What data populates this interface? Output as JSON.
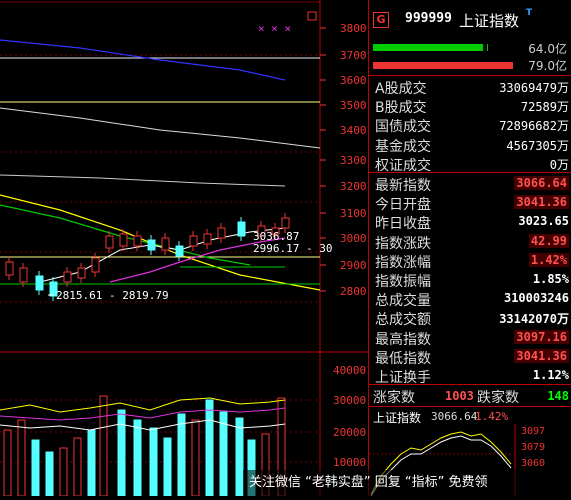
{
  "chart": {
    "price_ticks": [
      "3800",
      "3700",
      "3600",
      "3500",
      "3400",
      "3300",
      "3200",
      "3100",
      "3000",
      "2900",
      "2800"
    ],
    "volume_ticks": [
      "40000",
      "30000",
      "20000",
      "10000"
    ],
    "annotations": {
      "low_range": "2815.61 - 2819.79",
      "high_a": "3036.87",
      "high_b": "2996.17 - 30"
    },
    "marks": "× × ×"
  },
  "panel": {
    "badge": "G",
    "code": "999999",
    "name": "上证指数",
    "tmark": "T",
    "vol_top": "64.0亿",
    "vol_bottom": "79.0亿",
    "rows_a": [
      {
        "k": "A股成交",
        "v": "33069479万"
      },
      {
        "k": "B股成交",
        "v": "72589万"
      },
      {
        "k": "国债成交",
        "v": "72896682万"
      },
      {
        "k": "基金成交",
        "v": "4567305万"
      },
      {
        "k": "权证成交",
        "v": "0万"
      }
    ],
    "rows_b": [
      {
        "k": "最新指数",
        "v": "3066.64"
      },
      {
        "k": "今日开盘",
        "v": "3041.36"
      },
      {
        "k": "昨日收盘",
        "v": "3023.65"
      },
      {
        "k": "指数涨跌",
        "v": "42.99"
      },
      {
        "k": "指数涨幅",
        "v": "1.42%"
      },
      {
        "k": "指数振幅",
        "v": "1.85%"
      },
      {
        "k": "总成交量",
        "v": "310003246"
      },
      {
        "k": "总成交额",
        "v": "33142070万"
      },
      {
        "k": "最高指数",
        "v": "3097.16"
      },
      {
        "k": "最低指数",
        "v": "3041.36"
      },
      {
        "k": "上证换手",
        "v": "1.12%"
      }
    ],
    "up_label": "涨家数",
    "up_count": "1003",
    "down_label": "跌家数",
    "down_count": "148",
    "mini_title": "上证指数",
    "mini_price": "3066.64",
    "mini_change": "1.42%",
    "mini_ticks": [
      "3097",
      "3079",
      "3060"
    ]
  },
  "watermark": "关注微信 “老韩实盘” 回复 “指标” 免费领"
}
